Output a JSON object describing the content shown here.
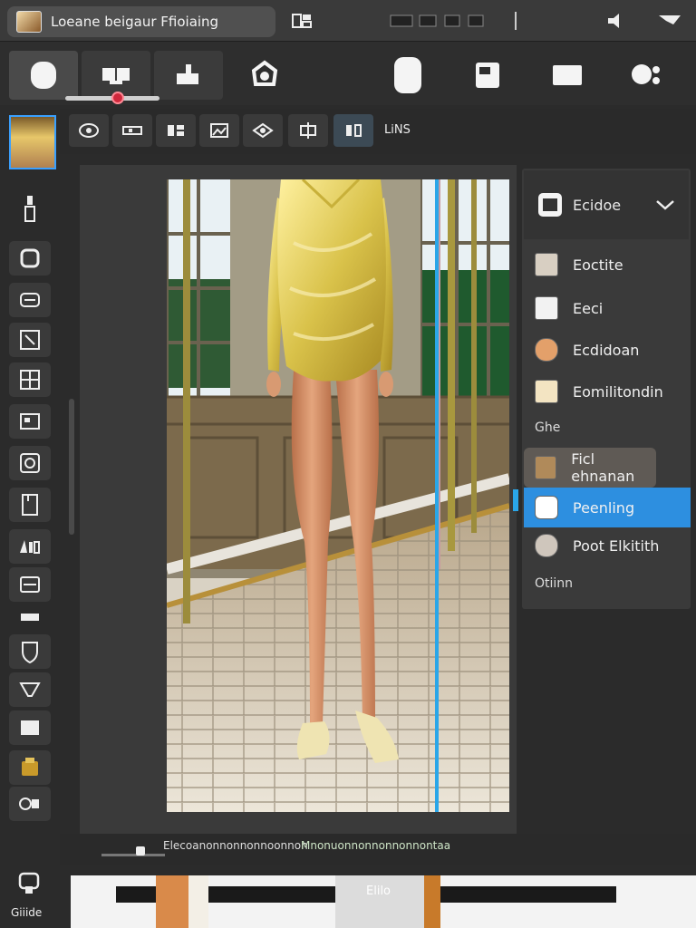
{
  "window": {
    "title": "Loeane beigaur Ffioiaing"
  },
  "toolbar": {
    "zoom_fraction": 0.56
  },
  "subbar": {
    "label": "LiNS"
  },
  "panel": {
    "header": "Ecidoe",
    "items": [
      {
        "label": "Eoctite",
        "swatch": "#d8cfc2"
      },
      {
        "label": "Eeci",
        "swatch": "#f2f2f2"
      },
      {
        "label": "Ecdidoan",
        "swatch": "#e3a06a"
      },
      {
        "label": "Eomilitondin",
        "swatch": "#f3e4c2"
      }
    ],
    "section1": "Ghe",
    "hover_item": {
      "label": "Ficl ehnanan",
      "swatch": "#b08a5a"
    },
    "selected_item": {
      "label": "Peenling",
      "swatch": "#ffffff"
    },
    "item_after": {
      "label": "Poot Elkitith",
      "swatch": "#cfc6bc"
    },
    "section2": "Otiinn"
  },
  "status": {
    "left": "Elecoanonnonnonnoonnon",
    "right": "Mnonuonnonnonnonnontaa"
  },
  "bottom": {
    "label": "Giiide",
    "film_label": "Elilo"
  },
  "colors": {
    "accent": "#2d8fe0",
    "guide": "#2aa6e8",
    "zoom_knob": "#d0283c"
  }
}
